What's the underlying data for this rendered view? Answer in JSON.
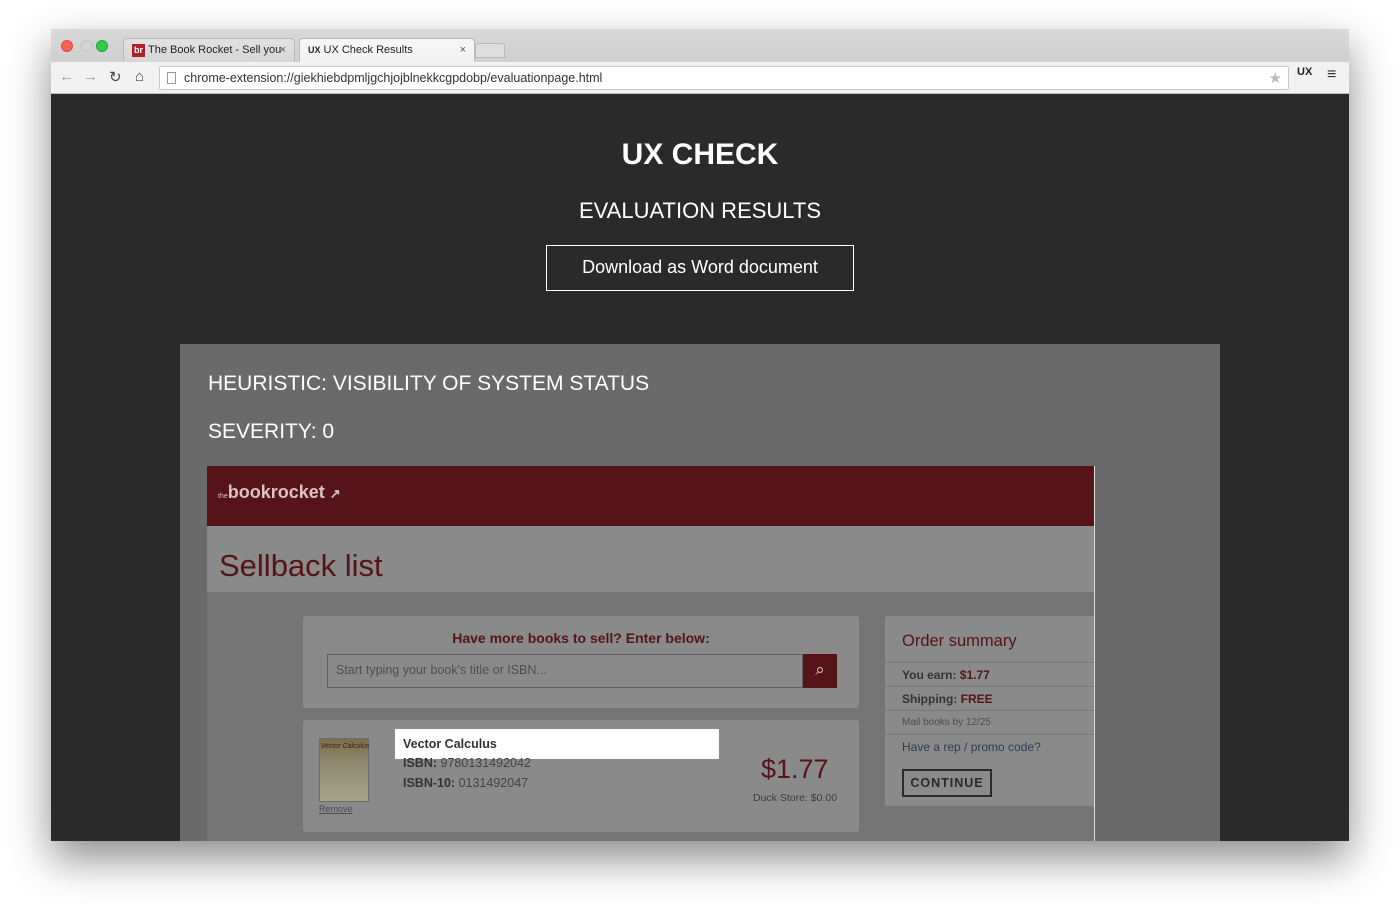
{
  "browser": {
    "tabs": [
      {
        "label": "The Book Rocket - Sell you",
        "favicon": "br",
        "close": "×"
      },
      {
        "label": "UX Check Results",
        "favicon": "UX",
        "close": "×"
      }
    ],
    "url": "chrome-extension://giekhiebdpmljgchjojblnekkcgpdobp/evaluationpage.html",
    "extension_label": "UX",
    "icons": {
      "back": "←",
      "forward": "→",
      "reload": "↻",
      "home": "⌂",
      "star": "★",
      "menu": "≡"
    }
  },
  "page": {
    "title": "UX CHECK",
    "subtitle": "EVALUATION RESULTS",
    "download_label": "Download as Word document"
  },
  "result": {
    "heuristic": "HEURISTIC: VISIBILITY OF SYSTEM STATUS",
    "severity": "SEVERITY: 0"
  },
  "screenshot": {
    "logo_prefix": "the",
    "logo": "bookrocket",
    "heading": "Sellback list",
    "search_label": "Have more books to sell? Enter below:",
    "search_placeholder": "Start typing your book's title or ISBN...",
    "book": {
      "title": "Vector Calculus",
      "cover_text": "Vector Calculus",
      "isbn_label": "ISBN:",
      "isbn": "9780131492042",
      "isbn10_label": "ISBN-10:",
      "isbn10": "0131492047",
      "price": "$1.77",
      "duck_store": "Duck Store: $0.00",
      "remove": "Remove"
    },
    "summary": {
      "title": "Order summary",
      "earn_label": "You earn:",
      "earn_value": "$1.77",
      "shipping_label": "Shipping:",
      "shipping_value": "FREE",
      "mail_note": "Mail books by 12/25",
      "promo_link": "Have a rep / promo code?",
      "continue": "CONTINUE"
    }
  }
}
